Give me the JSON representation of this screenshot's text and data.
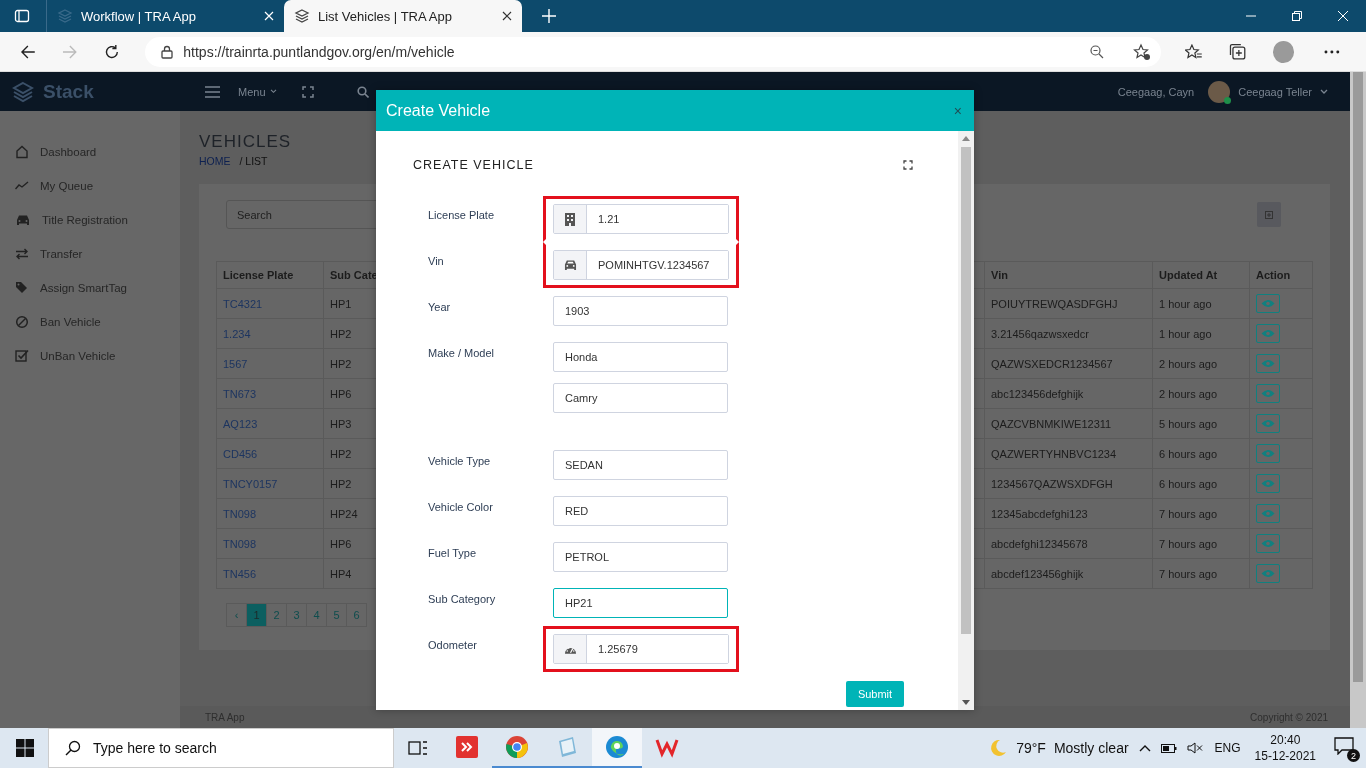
{
  "browser": {
    "tabs": [
      {
        "title": "Workflow | TRA App",
        "selected": false
      },
      {
        "title": "List Vehicles | TRA App",
        "selected": true
      }
    ],
    "url": "https://trainrta.puntlandgov.org/en/m/vehicle",
    "forward_disabled": true
  },
  "header": {
    "logo": "Stack",
    "menu": "Menu",
    "user_short": "Ceegaag, Cayn",
    "user_name": "Ceegaag Teller",
    "online": true
  },
  "sidebar": {
    "items": [
      {
        "label": "Dashboard"
      },
      {
        "label": "My Queue"
      },
      {
        "label": "Title Registration"
      },
      {
        "label": "Transfer"
      },
      {
        "label": "Assign SmartTag"
      },
      {
        "label": "Ban Vehicle"
      },
      {
        "label": "UnBan Vehicle"
      }
    ]
  },
  "page": {
    "title": "VEHICLES",
    "breadcrumb": [
      "HOME",
      "/ LIST"
    ],
    "search": {
      "placeholder": "Search"
    }
  },
  "table": {
    "columns": [
      "License Plate",
      "Sub Cate",
      "Vin",
      "Updated At",
      "Action"
    ],
    "rows": [
      {
        "license_plate": "TC4321",
        "sub_category": "HP1",
        "vin": "POIUYTREWQASDFGHJ",
        "updated_at": "1 hour ago"
      },
      {
        "license_plate": "1.234",
        "sub_category": "HP2",
        "vin": "3.21456qazwsxedcr",
        "updated_at": "1 hour ago"
      },
      {
        "license_plate": "1567",
        "sub_category": "HP2",
        "vin": "QAZWSXEDCR1234567",
        "updated_at": "2 hours ago"
      },
      {
        "license_plate": "TN673",
        "sub_category": "HP6",
        "vin": "abc123456defghijk",
        "updated_at": "2 hours ago"
      },
      {
        "license_plate": "AQ123",
        "sub_category": "HP3",
        "vin": "QAZCVBNMKIWE12311",
        "updated_at": "5 hours ago"
      },
      {
        "license_plate": "CD456",
        "sub_category": "HP2",
        "vin": "QAZWERTYHNBVC1234",
        "updated_at": "6 hours ago"
      },
      {
        "license_plate": "TNCY0157",
        "sub_category": "HP2",
        "vin": "1234567QAZWSXDFGH",
        "updated_at": "6 hours ago"
      },
      {
        "license_plate": "TN098",
        "sub_category": "HP24",
        "vin": "12345abcdefghi123",
        "updated_at": "7 hours ago"
      },
      {
        "license_plate": "TN098",
        "sub_category": "HP6",
        "vin": "abcdefghi12345678",
        "updated_at": "7 hours ago"
      },
      {
        "license_plate": "TN456",
        "sub_category": "HP4",
        "vin": "abcdef123456ghijk",
        "updated_at": "7 hours ago"
      }
    ]
  },
  "pagination": {
    "pages": [
      {
        "label": "‹",
        "selected": false
      },
      {
        "label": "1",
        "selected": true
      },
      {
        "label": "2",
        "selected": false
      },
      {
        "label": "3",
        "selected": false
      },
      {
        "label": "4",
        "selected": false
      },
      {
        "label": "5",
        "selected": false
      },
      {
        "label": "6",
        "selected": false
      }
    ]
  },
  "footer": {
    "left": "TRA App",
    "right": "Copyright © 2021"
  },
  "modal": {
    "title": "Create Vehicle",
    "close": "×",
    "heading": "CREATE VEHICLE",
    "submit": "Submit",
    "rows": [
      {
        "label": "License Plate",
        "kind": "icon",
        "highlighted": true,
        "inputs": [
          {
            "value": "1.21",
            "focused": false
          }
        ]
      },
      {
        "label": "Vin",
        "kind": "icon",
        "highlighted": true,
        "inputs": [
          {
            "value": "POMINHTGV.1234567",
            "focused": false
          }
        ]
      },
      {
        "label": "Year",
        "kind": "plain",
        "highlighted": false,
        "inputs": [
          {
            "value": "1903",
            "focused": false
          }
        ]
      },
      {
        "label": "Make / Model",
        "kind": "plain",
        "highlighted": false,
        "inputs": [
          {
            "value": "Honda",
            "focused": false
          },
          {
            "value": "Camry",
            "focused": false
          }
        ]
      },
      {
        "label": "Vehicle Type",
        "kind": "plain",
        "highlighted": false,
        "inputs": [
          {
            "value": "SEDAN",
            "focused": false
          }
        ]
      },
      {
        "label": "Vehicle Color",
        "kind": "plain",
        "highlighted": false,
        "inputs": [
          {
            "value": "RED",
            "focused": false
          }
        ]
      },
      {
        "label": "Fuel Type",
        "kind": "plain",
        "highlighted": false,
        "inputs": [
          {
            "value": "PETROL",
            "focused": false
          }
        ]
      },
      {
        "label": "Sub Category",
        "kind": "plain",
        "highlighted": false,
        "inputs": [
          {
            "value": "HP21",
            "focused": true
          }
        ]
      },
      {
        "label": "Odometer",
        "kind": "icon",
        "highlighted": true,
        "inputs": [
          {
            "value": "1.25679",
            "focused": false
          }
        ]
      }
    ]
  },
  "taskbar": {
    "search_placeholder": "Type here to search",
    "apps": [
      {
        "running": false,
        "selected": false
      },
      {
        "running": true,
        "selected": false
      },
      {
        "running": true,
        "selected": false
      },
      {
        "running": true,
        "selected": true
      },
      {
        "running": false,
        "selected": false
      }
    ],
    "weather": {
      "temp": "79°F",
      "text": "Mostly clear"
    },
    "language": "ENG",
    "time": "20:40",
    "date": "15-12-2021",
    "notifications": "2"
  }
}
